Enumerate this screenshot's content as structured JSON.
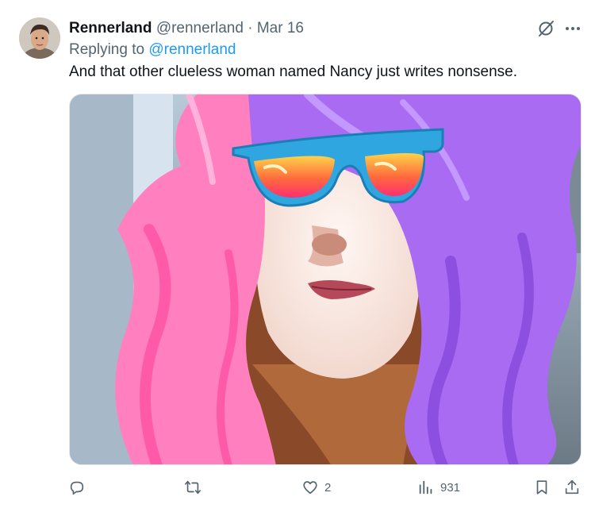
{
  "tweet": {
    "author": {
      "name": "Rennerland",
      "handle": "@rennerland"
    },
    "separator": "·",
    "date": "Mar 16",
    "replying_to_label": "Replying to",
    "replying_to_handle": "@rennerland",
    "text": "And that other clueless woman named Nancy just writes nonsense.",
    "media": {
      "description_icon": "photo-with-cartoon-wig-and-sunglasses"
    }
  },
  "header_icons": [
    "grok-icon",
    "more-icon"
  ],
  "actions": {
    "reply": {
      "icon": "reply-icon",
      "count": ""
    },
    "retweet": {
      "icon": "retweet-icon",
      "count": ""
    },
    "like": {
      "icon": "heart-icon",
      "count": "2"
    },
    "views": {
      "icon": "views-chart-icon",
      "count": "931"
    },
    "bookmark": {
      "icon": "bookmark-icon"
    },
    "share": {
      "icon": "share-icon"
    }
  },
  "colors": {
    "text": "#0f1419",
    "secondary": "#536471",
    "link": "#1d9bf0",
    "pink_hair": "#ff7fbf",
    "purple_hair": "#a86bf2",
    "glasses_frame": "#2fa6e0"
  }
}
